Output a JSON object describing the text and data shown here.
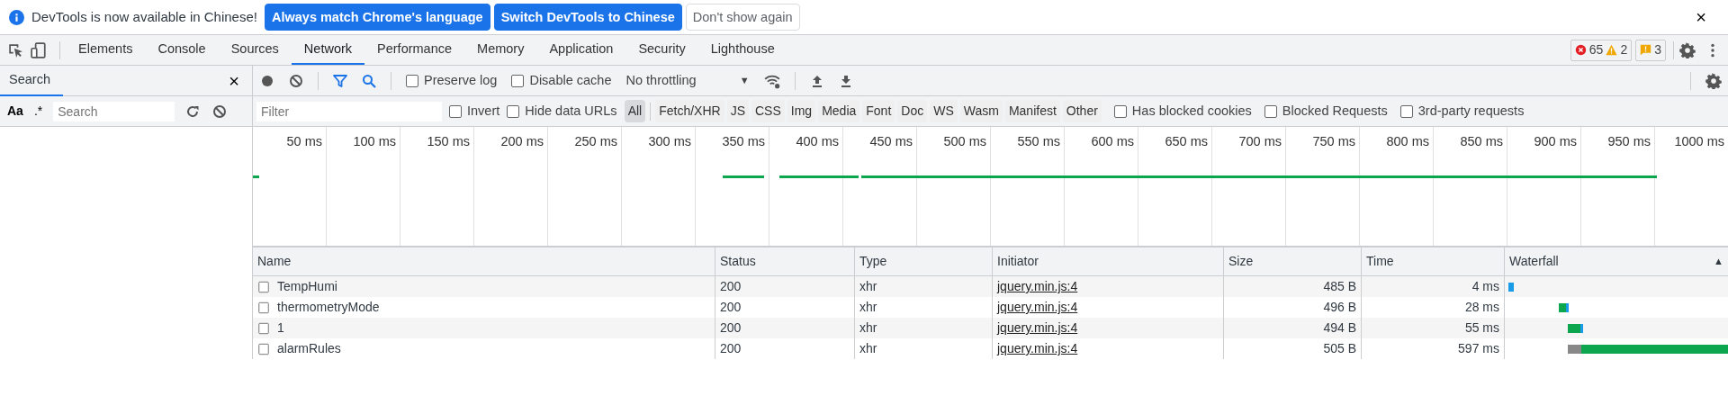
{
  "infobar": {
    "message": "DevTools is now available in Chinese!",
    "close": "×",
    "buttons": [
      {
        "label": "Always match Chrome's language",
        "kind": "primary"
      },
      {
        "label": "Switch DevTools to Chinese",
        "kind": "primary"
      },
      {
        "label": "Don't show again",
        "kind": "plain"
      }
    ]
  },
  "tabs": [
    {
      "label": "Elements",
      "selected": false
    },
    {
      "label": "Console",
      "selected": false
    },
    {
      "label": "Sources",
      "selected": false
    },
    {
      "label": "Network",
      "selected": true
    },
    {
      "label": "Performance",
      "selected": false
    },
    {
      "label": "Memory",
      "selected": false
    },
    {
      "label": "Application",
      "selected": false
    },
    {
      "label": "Security",
      "selected": false
    },
    {
      "label": "Lighthouse",
      "selected": false
    }
  ],
  "counters": {
    "errors": "65",
    "warnings": "2",
    "issues": "3"
  },
  "search_panel": {
    "title": "Search",
    "close": "×",
    "case_toggle": "Aa",
    "regex_toggle": ".*",
    "placeholder": "Search"
  },
  "toolbar": {
    "options": [
      {
        "label": "Preserve log",
        "checked": false
      },
      {
        "label": "Disable cache",
        "checked": false
      }
    ],
    "throttling": "No throttling",
    "throttling_caret": "▼"
  },
  "filter_bar": {
    "placeholder": "Filter",
    "options": [
      {
        "label": "Invert",
        "checked": false
      },
      {
        "label": "Hide data URLs",
        "checked": false
      }
    ],
    "types": [
      {
        "label": "All",
        "selected": true
      },
      {
        "label": "Fetch/XHR",
        "selected": false
      },
      {
        "label": "JS",
        "selected": false
      },
      {
        "label": "CSS",
        "selected": false
      },
      {
        "label": "Img",
        "selected": false
      },
      {
        "label": "Media",
        "selected": false
      },
      {
        "label": "Font",
        "selected": false
      },
      {
        "label": "Doc",
        "selected": false
      },
      {
        "label": "WS",
        "selected": false
      },
      {
        "label": "Wasm",
        "selected": false
      },
      {
        "label": "Manifest",
        "selected": false
      },
      {
        "label": "Other",
        "selected": false
      }
    ],
    "extra_options": [
      {
        "label": "Has blocked cookies",
        "checked": false
      },
      {
        "label": "Blocked Requests",
        "checked": false
      },
      {
        "label": "3rd-party requests",
        "checked": false
      }
    ]
  },
  "timeline": {
    "ticks": [
      "50 ms",
      "100 ms",
      "150 ms",
      "200 ms",
      "250 ms",
      "300 ms",
      "350 ms",
      "400 ms",
      "450 ms",
      "500 ms",
      "550 ms",
      "600 ms",
      "650 ms",
      "700 ms",
      "750 ms",
      "800 ms",
      "850 ms",
      "900 ms",
      "950 ms",
      "1000 ms"
    ]
  },
  "table": {
    "columns": [
      "Name",
      "Status",
      "Type",
      "Initiator",
      "Size",
      "Time",
      "Waterfall"
    ],
    "sort_indicator": "▲",
    "rows": [
      {
        "name": "TempHumi",
        "status": "200",
        "type": "xhr",
        "initiator": "jquery.min.js:4",
        "size": "485 B",
        "time": "4 ms"
      },
      {
        "name": "thermometryMode",
        "status": "200",
        "type": "xhr",
        "initiator": "jquery.min.js:4",
        "size": "496 B",
        "time": "28 ms"
      },
      {
        "name": "1",
        "status": "200",
        "type": "xhr",
        "initiator": "jquery.min.js:4",
        "size": "494 B",
        "time": "55 ms"
      },
      {
        "name": "alarmRules",
        "status": "200",
        "type": "xhr",
        "initiator": "jquery.min.js:4",
        "size": "505 B",
        "time": "597 ms"
      }
    ]
  }
}
